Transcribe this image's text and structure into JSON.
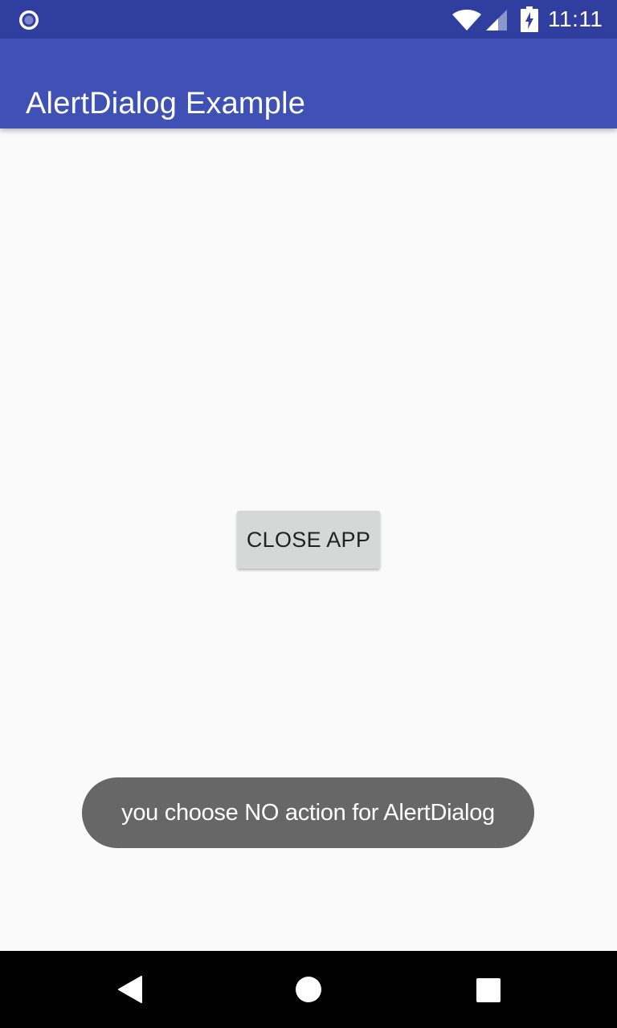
{
  "status_bar": {
    "time": "11:11",
    "background_color": "#303f9f",
    "icons": [
      "radio-button-icon",
      "wifi-icon",
      "cell-signal-icon",
      "battery-charging-icon"
    ]
  },
  "app_bar": {
    "title": "AlertDialog Example",
    "background_color": "#3f51b5"
  },
  "main": {
    "close_button_label": "CLOSE APP"
  },
  "toast": {
    "message": "you choose NO action for AlertDialog"
  },
  "nav_bar": {
    "icons": [
      "back-icon",
      "home-icon",
      "recents-icon"
    ]
  }
}
